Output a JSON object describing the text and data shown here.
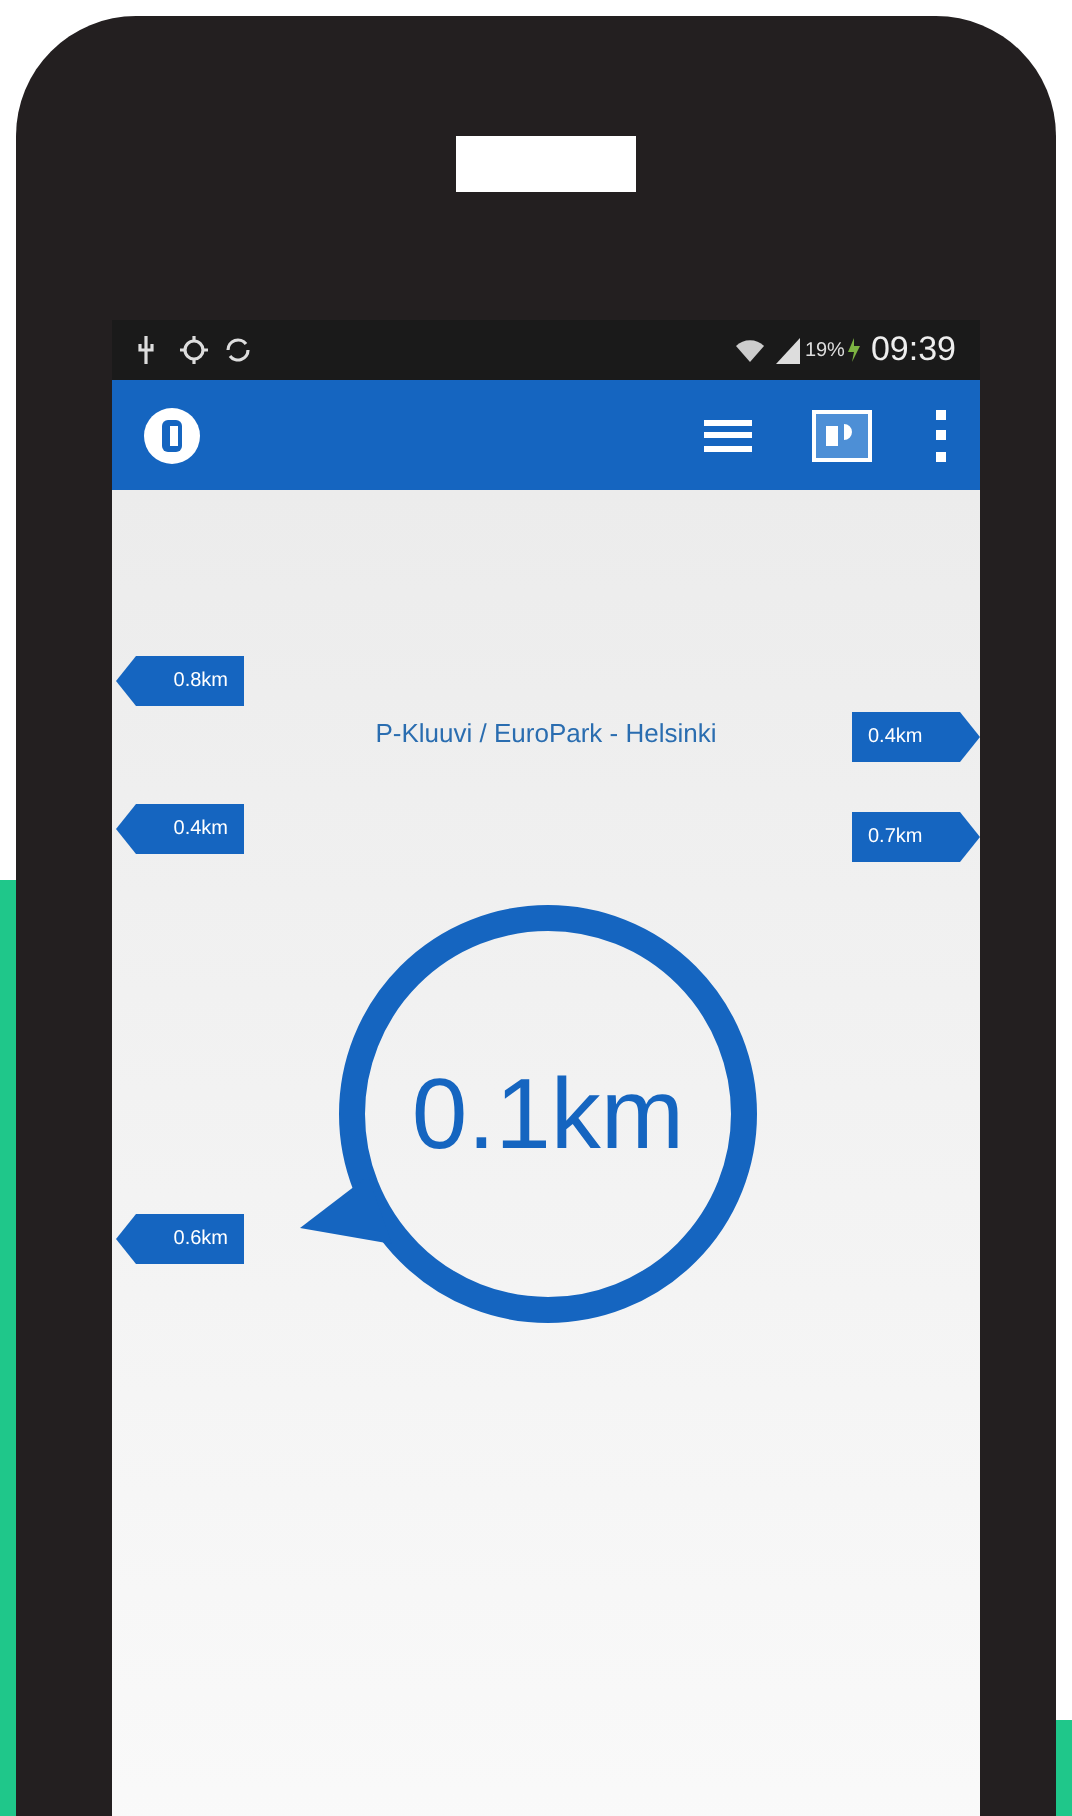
{
  "status_bar": {
    "battery": "19%",
    "time": "09:39"
  },
  "destination": {
    "name": "P-Kluuvi / EuroPark - Helsinki",
    "distance": "0.1km"
  },
  "markers": [
    {
      "label": "0.8km",
      "kind": "left"
    },
    {
      "label": "0.4km",
      "kind": "right"
    },
    {
      "label": "0.4km",
      "kind": "left"
    },
    {
      "label": "0.7km",
      "kind": "right"
    },
    {
      "label": "0.6km",
      "kind": "left"
    }
  ]
}
